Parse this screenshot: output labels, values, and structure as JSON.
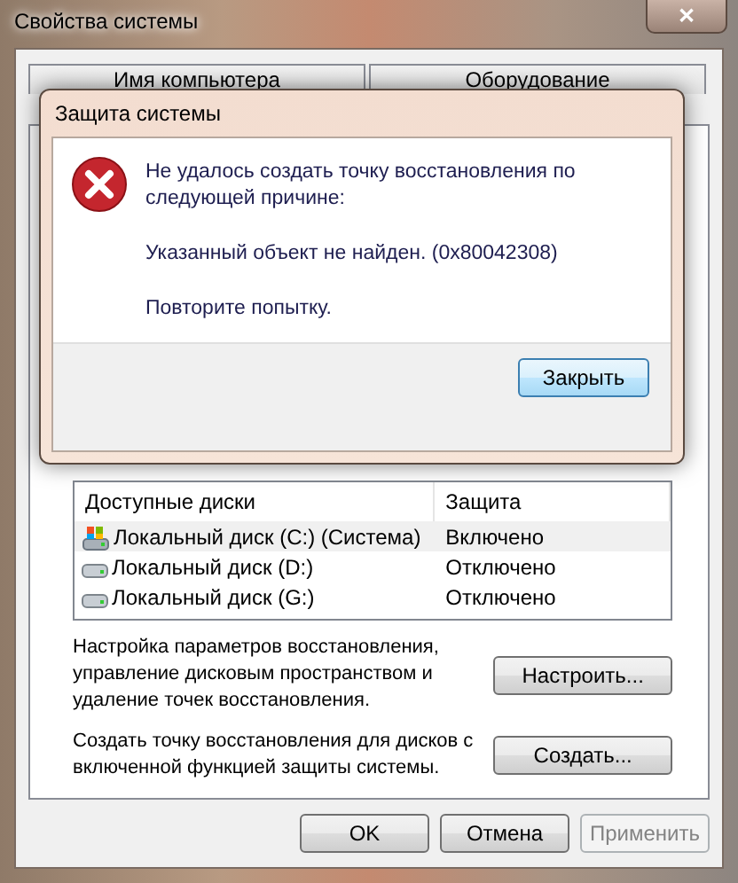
{
  "window": {
    "title": "Свойства системы",
    "close": "✕"
  },
  "tabs": [
    {
      "label": "Имя компьютера",
      "selected": false
    },
    {
      "label": "Оборудование",
      "selected": false
    }
  ],
  "disks": {
    "columns": [
      "Доступные диски",
      "Защита"
    ],
    "rows": [
      {
        "name": "Локальный диск (C:) (Система)",
        "protection": "Включено",
        "kind": "system",
        "selected": true
      },
      {
        "name": "Локальный диск (D:)",
        "protection": "Отключено",
        "kind": "drive",
        "selected": false
      },
      {
        "name": "Локальный диск (G:)",
        "protection": "Отключено",
        "kind": "drive",
        "selected": false
      }
    ]
  },
  "actions": [
    {
      "text": "Настройка параметров восстановления, управление дисковым пространством и удаление точек восстановления.",
      "button": "Настроить..."
    },
    {
      "text": "Создать точку восстановления для дисков с включенной функцией защиты системы.",
      "button": "Создать..."
    }
  ],
  "buttons": [
    {
      "label": "OK",
      "disabled": false
    },
    {
      "label": "Отмена",
      "disabled": false
    },
    {
      "label": "Применить",
      "disabled": true
    }
  ],
  "dialog": {
    "title": "Защита системы",
    "lines": [
      "Не удалось создать точку восстановления по следующей причине:",
      "Указанный объект не найден. (0x80042308)",
      "Повторите попытку."
    ],
    "button": "Закрыть"
  }
}
